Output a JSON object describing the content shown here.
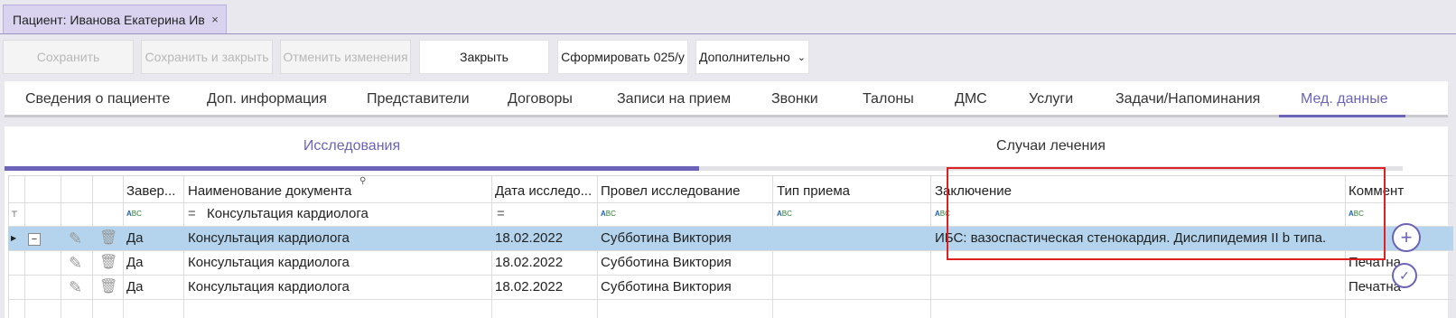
{
  "doc_tab": {
    "title": "Пациент: Иванова Екатерина Ив...",
    "close": "×"
  },
  "toolbar": {
    "save": "Сохранить",
    "save_close": "Сохранить и закрыть",
    "cancel": "Отменить изменения",
    "close": "Закрыть",
    "form": "Сформировать 025/у",
    "more": "Дополнительно"
  },
  "tabs": [
    "Сведения о пациенте",
    "Доп. информация",
    "Представители",
    "Договоры",
    "Записи на прием",
    "Звонки",
    "Талоны",
    "ДМС",
    "Услуги",
    "Задачи/Напоминания",
    "Мед. данные"
  ],
  "subtabs": [
    "Исследования",
    "Случаи лечения"
  ],
  "grid": {
    "headers": [
      "Завер...",
      "Наименование документа",
      "Дата исследо...",
      "Провел исследование",
      "Тип приема",
      "Заключение",
      "Коммент"
    ],
    "filters": {
      "name": "Консультация кардиолога",
      "eq": "="
    },
    "rows": [
      {
        "done": "Да",
        "name": "Консультация кардиолога",
        "date": "18.02.2022",
        "doctor": "Субботина Виктория",
        "type": "",
        "conclusion": "ИБС: вазоспастическая стенокардия. Дислипидемия II b типа.",
        "comment": ""
      },
      {
        "done": "Да",
        "name": "Консультация кардиолога",
        "date": "18.02.2022",
        "doctor": "Субботина Виктория",
        "type": "",
        "conclusion": "",
        "comment": "Печатна"
      },
      {
        "done": "Да",
        "name": "Консультация кардиолога",
        "date": "18.02.2022",
        "doctor": "Субботина Виктория",
        "type": "",
        "conclusion": "",
        "comment": "Печатна"
      }
    ]
  },
  "colors": {
    "accent": "#6b63b8",
    "selected_row": "#b3d4ec",
    "highlight": "#e02020"
  }
}
